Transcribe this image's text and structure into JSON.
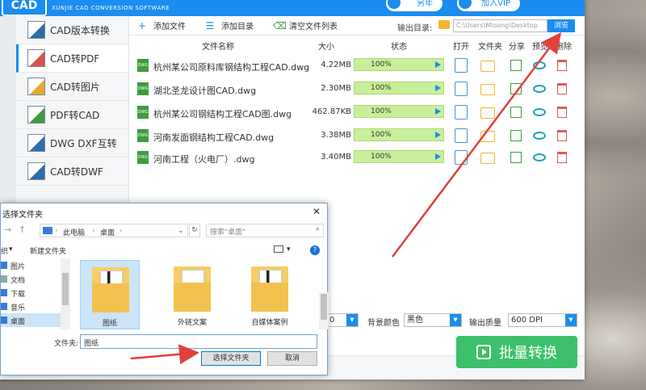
{
  "app": {
    "logo": "CAD",
    "subtitle": "XUNJIE CAD CONVERSION SOFTWARE",
    "register": "另年",
    "vip": "加入VIP"
  },
  "sidebar": {
    "items": [
      {
        "label": "CAD版本转换",
        "icon": "cad-version-icon"
      },
      {
        "label": "CAD转PDF",
        "icon": "cad-pdf-icon"
      },
      {
        "label": "CAD转图片",
        "icon": "cad-image-icon"
      },
      {
        "label": "PDF转CAD",
        "icon": "pdf-cad-icon"
      },
      {
        "label": "DWG DXF互转",
        "icon": "dwg-dxf-icon"
      },
      {
        "label": "CAD转DWF",
        "icon": "cad-dwf-icon"
      }
    ],
    "active_index": 1
  },
  "toolbar": {
    "add_file": "添加文件",
    "add_dir": "添加目录",
    "clear_list": "清空文件列表",
    "output_label": "输出目录:",
    "output_path": "C:\\Users\\Mloong\\Desktop",
    "browse": "浏览"
  },
  "table": {
    "headers": {
      "name": "文件名称",
      "size": "大小",
      "status": "状态",
      "open": "打开",
      "folder": "文件夹",
      "share": "分享",
      "preview": "预览",
      "delete": "删除"
    },
    "rows": [
      {
        "name": "杭州某公司原料库钢结构工程CAD.dwg",
        "size": "4.22MB",
        "progress": "100%"
      },
      {
        "name": "湖北圣龙设计图CAD.dwg",
        "size": "2.30MB",
        "progress": "100%"
      },
      {
        "name": "杭州某公司钢结构工程CAD图.dwg",
        "size": "462.87KB",
        "progress": "100%"
      },
      {
        "name": "河南发面钢结构工程CAD.dwg",
        "size": "3.38MB",
        "progress": "100%"
      },
      {
        "name": "河南工程（火电厂）.dwg",
        "size": "3.40MB",
        "progress": "100%"
      }
    ]
  },
  "bottom": {
    "first_select": "0",
    "bg_color_label": "背景颜色",
    "bg_color_value": "黑色",
    "quality_label": "输出质量",
    "quality_value": "600 DPI",
    "convert": "批量转换"
  },
  "dialog": {
    "title": "选择文件夹",
    "path_pc": "此电脑",
    "path_desktop": "桌面",
    "search_placeholder": "搜索\"桌面\"",
    "organize": "织",
    "new_folder": "新建文件夹",
    "tree": [
      "图片",
      "文档",
      "下载",
      "音乐",
      "桌面"
    ],
    "files": [
      "图纸",
      "外链文案",
      "自媒体案例"
    ],
    "filename_label": "文件夹:",
    "filename_value": "图纸",
    "select_btn": "选择文件夹",
    "cancel_btn": "取消"
  },
  "colors": {
    "brand_blue": "#1a8df0",
    "progress_green": "#c9ef9b",
    "convert_green": "#3cc06a",
    "arrow_red": "#e0413a"
  }
}
